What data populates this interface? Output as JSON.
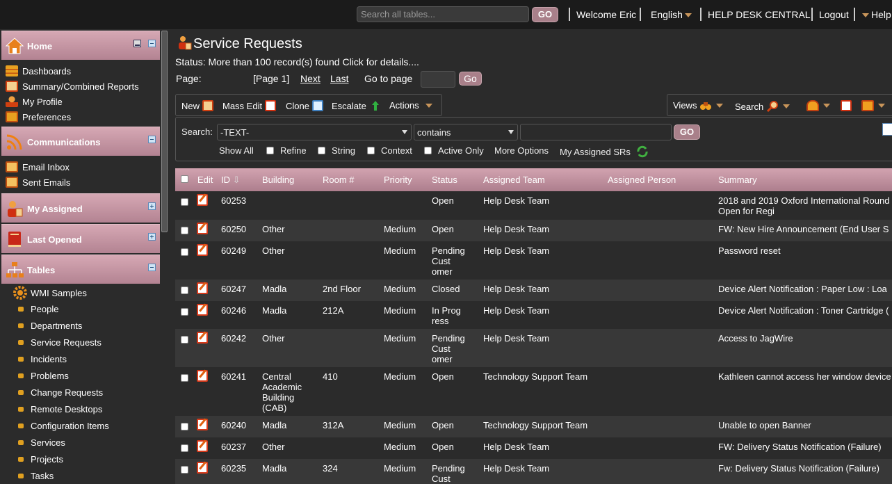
{
  "topbar": {
    "search_placeholder": "Search all tables...",
    "go_label": "GO",
    "welcome": "Welcome Eric",
    "language": "English",
    "help_desk": "HELP DESK CENTRAL",
    "logout": "Logout",
    "help": "Help"
  },
  "sidebar": {
    "home": {
      "title": "Home",
      "items": [
        "Dashboards",
        "Summary/Combined Reports",
        "My Profile",
        "Preferences"
      ]
    },
    "communications": {
      "title": "Communications",
      "items": [
        "Email Inbox",
        "Sent Emails"
      ]
    },
    "my_assigned": {
      "title": "My Assigned"
    },
    "last_opened": {
      "title": "Last Opened"
    },
    "tables": {
      "title": "Tables",
      "group": "WMI Samples",
      "items": [
        "People",
        "Departments",
        "Service Requests",
        "Incidents",
        "Problems",
        "Change Requests",
        "Remote Desktops",
        "Configuration Items",
        "Services",
        "Projects",
        "Tasks"
      ]
    }
  },
  "main": {
    "title": "Service Requests",
    "status_prefix": "Status: More than 100 record(s) found",
    "status_link": "Click for details....",
    "pager": {
      "page_label": "Page:",
      "current": "[Page 1]",
      "next": "Next",
      "last": "Last",
      "goto_label": "Go to page",
      "go": "Go"
    },
    "toolbar": {
      "new": "New",
      "mass_edit": "Mass Edit",
      "clone": "Clone",
      "escalate": "Escalate",
      "actions": "Actions",
      "views": "Views",
      "search": "Search"
    },
    "search": {
      "label": "Search:",
      "field": "-TEXT-",
      "operator": "contains",
      "go": "GO",
      "show_all": "Show All",
      "refine": "Refine",
      "string": "String",
      "context": "Context",
      "active_only": "Active Only",
      "more_options": "More Options",
      "my_assigned": "My Assigned SRs"
    },
    "columns": [
      "Edit",
      "ID",
      "Building",
      "Room #",
      "Priority",
      "Status",
      "Assigned Team",
      "Assigned Person",
      "Summary"
    ],
    "rows": [
      {
        "id": "60253",
        "building": "",
        "room": "",
        "priority": "",
        "status": "Open",
        "team": "Help Desk Team",
        "person": "",
        "summary": "2018 and 2019 Oxford International Round Open for Regi"
      },
      {
        "id": "60250",
        "building": "Other",
        "room": "",
        "priority": "Medium",
        "status": "Open",
        "team": "Help Desk Team",
        "person": "",
        "summary": "FW: New Hire Announcement (End User S"
      },
      {
        "id": "60249",
        "building": "Other",
        "room": "",
        "priority": "Medium",
        "status": "Pending Cust omer",
        "team": "Help Desk Team",
        "person": "",
        "summary": "Password reset"
      },
      {
        "id": "60247",
        "building": "Madla",
        "room": "2nd Floor",
        "priority": "Medium",
        "status": "Closed",
        "team": "Help Desk Team",
        "person": "",
        "summary": "Device Alert Notification : Paper Low : Loa"
      },
      {
        "id": "60246",
        "building": "Madla",
        "room": "212A",
        "priority": "Medium",
        "status": "In Prog ress",
        "team": "Help Desk Team",
        "person": "",
        "summary": "Device Alert Notification : Toner Cartridge ("
      },
      {
        "id": "60242",
        "building": "Other",
        "room": "",
        "priority": "Medium",
        "status": "Pending Cust omer",
        "team": "Help Desk Team",
        "person": "",
        "summary": "Access to JagWire"
      },
      {
        "id": "60241",
        "building": "Central Academic Building (CAB)",
        "room": "410",
        "priority": "Medium",
        "status": "Open",
        "team": "Technology Support Team",
        "person": "",
        "summary": "Kathleen cannot access her window device"
      },
      {
        "id": "60240",
        "building": "Madla",
        "room": "312A",
        "priority": "Medium",
        "status": "Open",
        "team": "Technology Support Team",
        "person": "",
        "summary": "Unable to open Banner"
      },
      {
        "id": "60237",
        "building": "Other",
        "room": "",
        "priority": "Medium",
        "status": "Open",
        "team": "Help Desk Team",
        "person": "",
        "summary": "FW: Delivery Status Notification (Failure)"
      },
      {
        "id": "60235",
        "building": "Madla",
        "room": "324",
        "priority": "Medium",
        "status": "Pending Cust",
        "team": "Help Desk Team",
        "person": "",
        "summary": "Fw: Delivery Status Notification (Failure)"
      }
    ]
  }
}
